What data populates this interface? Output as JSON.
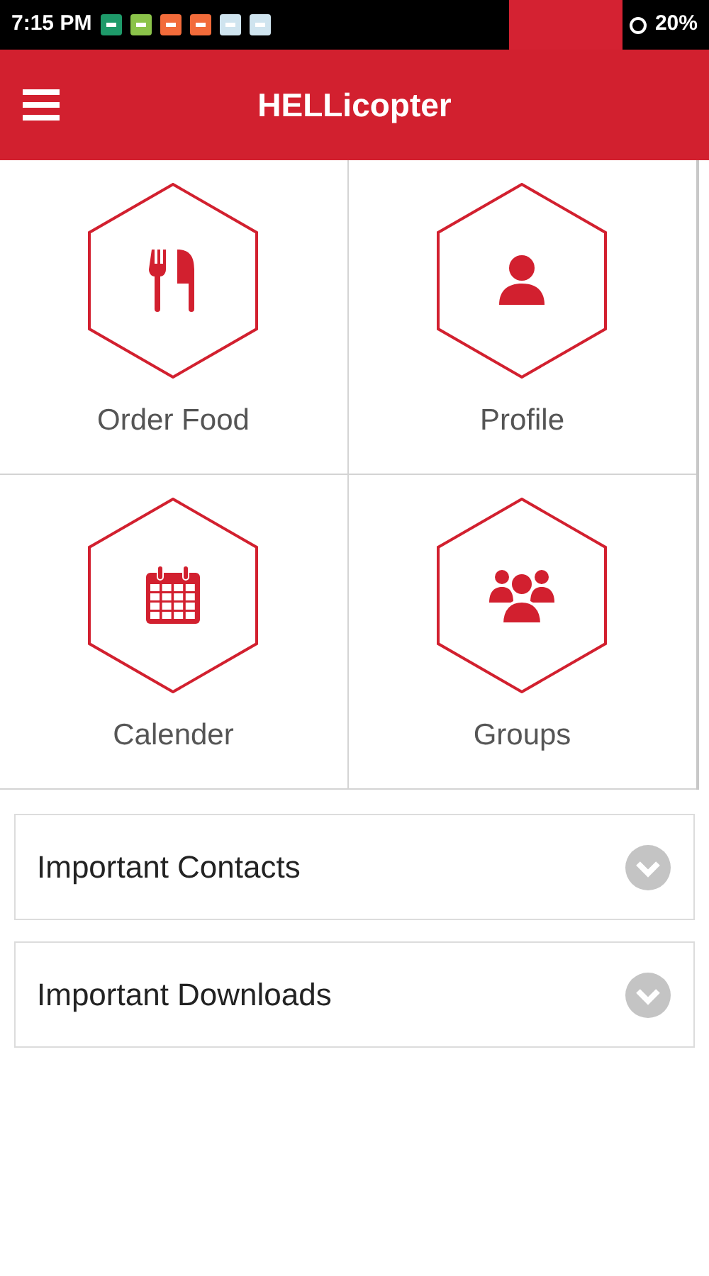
{
  "status_bar": {
    "time": "7:15 PM",
    "battery": "20%"
  },
  "header": {
    "title": "HELLicopter"
  },
  "tiles": [
    {
      "kind": "food",
      "label": "Order Food"
    },
    {
      "kind": "profile",
      "label": "Profile"
    },
    {
      "kind": "calendar",
      "label": "Calender"
    },
    {
      "kind": "groups",
      "label": "Groups"
    }
  ],
  "accordions": [
    {
      "title": "Important Contacts",
      "expanded": false
    },
    {
      "title": "Important Downloads",
      "expanded": false
    }
  ]
}
